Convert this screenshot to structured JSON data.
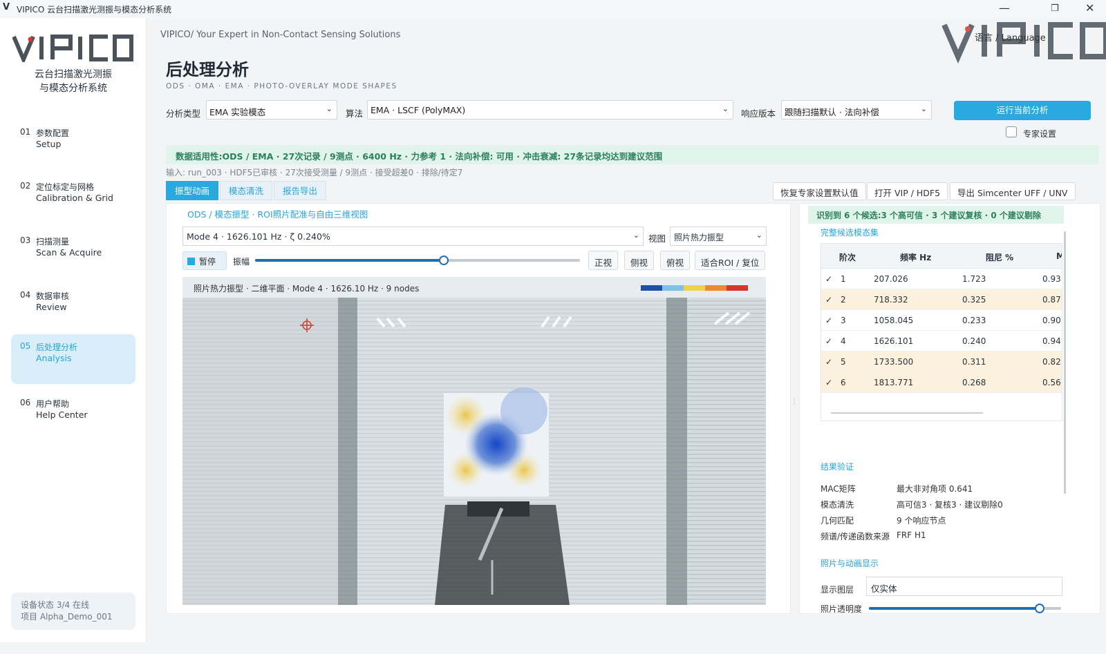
{
  "window": {
    "title": "VIPICO 云台扫描激光测振与模态分析系统",
    "minimize": "—",
    "maximize": "❐",
    "close": "✕"
  },
  "brand": {
    "logo": "VIPICO",
    "system_name_line1": "云台扫描激光测振",
    "system_name_line2": "与模态分析系统",
    "slogan": "VIPICO/ Your Expert in Non-Contact Sensing Solutions"
  },
  "nav": [
    {
      "num": "01",
      "cn": "参数配置",
      "en": "Setup"
    },
    {
      "num": "02",
      "cn": "定位标定与网格",
      "en": "Calibration & Grid"
    },
    {
      "num": "03",
      "cn": "扫描测量",
      "en": "Scan & Acquire"
    },
    {
      "num": "04",
      "cn": "数据审核",
      "en": "Review"
    },
    {
      "num": "05",
      "cn": "后处理分析",
      "en": "Analysis"
    },
    {
      "num": "06",
      "cn": "用户帮助",
      "en": "Help Center"
    }
  ],
  "status": {
    "device": "设备状态  3/4 在线",
    "project": "项目  Alpha_Demo_001"
  },
  "header": {
    "language_label": "语言 / Language"
  },
  "page": {
    "title": "后处理分析",
    "subtitle": "ODS · OMA · EMA · PHOTO-OVERLAY MODE SHAPES"
  },
  "controls": {
    "analysis_type_label": "分析类型",
    "analysis_type": "EMA 实验模态",
    "algorithm_label": "算法",
    "algorithm": "EMA · LSCF (PolyMAX)",
    "response_label": "响应版本",
    "response": "跟随扫描默认 · 法向补偿",
    "run_button": "运行当前分析",
    "expert_label": "专家设置"
  },
  "banner": "数据适用性:ODS / EMA · 27次记录 / 9测点 · 6400 Hz · 力参考 1 · 法向补偿: 可用 · 冲击衰减: 27条记录均达到建议范围",
  "input_info": "输入: run_003 · HDF5已审核 · 27次接受测量 / 9测点 · 接受超差0 · 排除/待定7",
  "tabs": [
    "振型动画",
    "模态清洗",
    "报告导出"
  ],
  "toolbar": {
    "restore": "恢复专家设置默认值",
    "open": "打开 VIP / HDF5",
    "export": "导出 Simcenter UFF / UNV"
  },
  "left_panel": {
    "title": "ODS / 模态振型 · ROI照片配准与自由三维视图",
    "mode_select": "Mode 4 · 1626.101 Hz · ζ 0.240%",
    "view_label": "视图",
    "view_select": "照片热力振型",
    "pause": "暂停",
    "amplitude": "振幅",
    "amplitude_level": 0.58,
    "view_buttons": [
      "正视",
      "侧视",
      "俯视",
      "适合ROI / 复位"
    ],
    "viewport_title": "照片热力振型 · 二维平面 · Mode 4 · 1626.10 Hz · 9 nodes",
    "colorbar": [
      "#1f4fa8",
      "#7ec3e6",
      "#f0d24a",
      "#f08a2c",
      "#d8342c"
    ]
  },
  "right_panel": {
    "header": "识别到 6 个候选:3 个高可信 · 3 个建议复核 · 0 个建议剔除",
    "subtitle": "完整候选模态集",
    "columns": [
      "阶次",
      "频率 Hz",
      "阻尼 %",
      "M"
    ],
    "rows": [
      {
        "order": "1",
        "freq": "207.026",
        "damp": "1.723",
        "mac": "0.93"
      },
      {
        "order": "2",
        "freq": "718.332",
        "damp": "0.325",
        "mac": "0.87"
      },
      {
        "order": "3",
        "freq": "1058.045",
        "damp": "0.233",
        "mac": "0.90"
      },
      {
        "order": "4",
        "freq": "1626.101",
        "damp": "0.240",
        "mac": "0.94"
      },
      {
        "order": "5",
        "freq": "1733.500",
        "damp": "0.311",
        "mac": "0.82"
      },
      {
        "order": "6",
        "freq": "1813.771",
        "damp": "0.268",
        "mac": "0.56"
      }
    ],
    "validation_title": "结果验证",
    "validation": [
      {
        "k": "MAC矩阵",
        "v": "最大非对角项 0.641"
      },
      {
        "k": "模态清洗",
        "v": "高可信3 · 复核3 · 建议剔除0"
      },
      {
        "k": "几何匹配",
        "v": "9 个响应节点"
      },
      {
        "k": "频谱/传递函数来源",
        "v": "FRF H1"
      }
    ],
    "photo_title": "照片与动画显示",
    "layer_label": "显示图层",
    "layer_value": "仅实体",
    "opacity_label": "照片透明度",
    "opacity_level": 0.89
  }
}
